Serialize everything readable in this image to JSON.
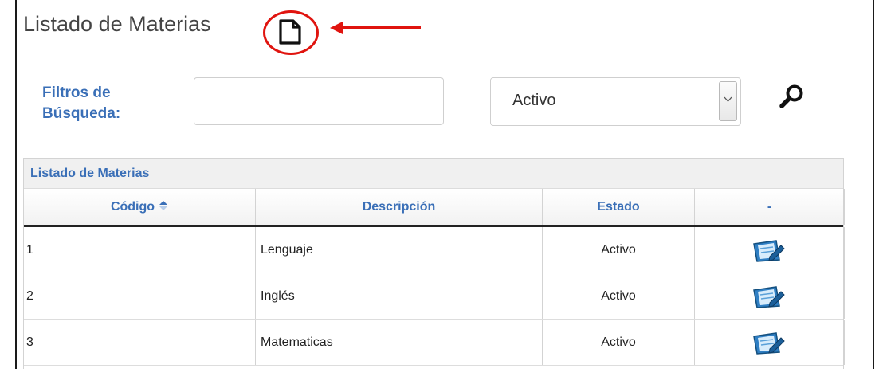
{
  "header": {
    "title": "Listado de Materias",
    "new_icon": "new-document-icon",
    "annotation_color": "#e0140f"
  },
  "filters": {
    "label": "Filtros de Búsqueda:",
    "search_value": "",
    "search_placeholder": "",
    "status_selected": "Activo",
    "search_icon": "magnifier-icon"
  },
  "grid": {
    "caption": "Listado de Materias",
    "columns": [
      "Código",
      "Descripción",
      "Estado",
      "-"
    ],
    "rows": [
      {
        "codigo": "1",
        "descripcion": "Lenguaje",
        "estado": "Activo"
      },
      {
        "codigo": "2",
        "descripcion": "Inglés",
        "estado": "Activo"
      },
      {
        "codigo": "3",
        "descripcion": "Matematicas",
        "estado": "Activo"
      }
    ],
    "row_action_icon": "edit-icon"
  },
  "colors": {
    "accent": "#3a6fb7",
    "annotation": "#e0140f"
  }
}
